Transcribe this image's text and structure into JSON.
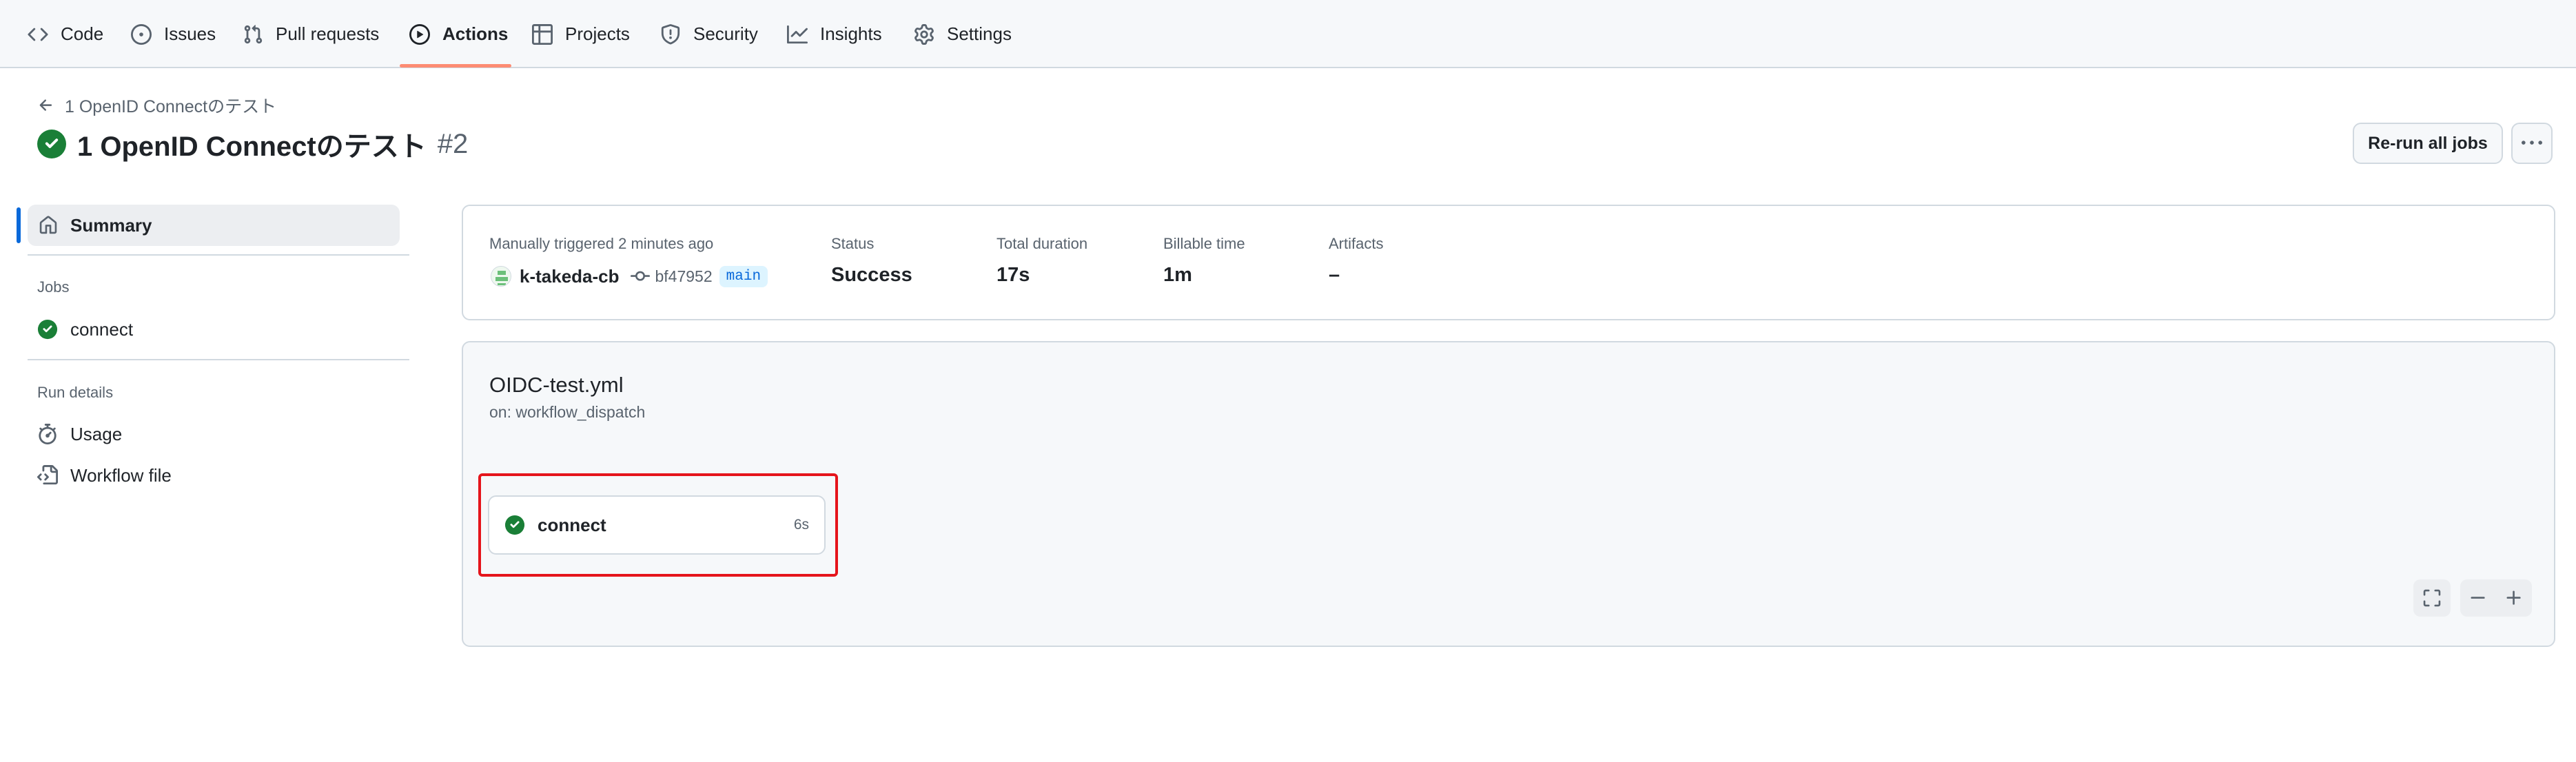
{
  "nav": {
    "tabs": [
      {
        "label": "Code",
        "icon": "code-icon"
      },
      {
        "label": "Issues",
        "icon": "issue-opened-icon"
      },
      {
        "label": "Pull requests",
        "icon": "git-pull-request-icon"
      },
      {
        "label": "Actions",
        "icon": "play-icon",
        "active": true
      },
      {
        "label": "Projects",
        "icon": "table-icon"
      },
      {
        "label": "Security",
        "icon": "shield-icon"
      },
      {
        "label": "Insights",
        "icon": "graph-icon"
      },
      {
        "label": "Settings",
        "icon": "gear-icon"
      }
    ]
  },
  "header": {
    "back_label": "1 OpenID Connectのテスト",
    "title": "1 OpenID Connectのテスト",
    "run_number": "#2",
    "rerun_label": "Re-run all jobs"
  },
  "sidebar": {
    "summary_label": "Summary",
    "jobs_heading": "Jobs",
    "jobs": [
      {
        "label": "connect",
        "status": "success"
      }
    ],
    "run_details_heading": "Run details",
    "details": [
      {
        "label": "Usage",
        "icon": "stopwatch-icon"
      },
      {
        "label": "Workflow file",
        "icon": "file-code-icon"
      }
    ]
  },
  "summary": {
    "trigger_text": "Manually triggered 2 minutes ago",
    "actor": "k-takeda-cb",
    "commit_sha": "bf47952",
    "branch": "main",
    "status_label": "Status",
    "status_value": "Success",
    "duration_label": "Total duration",
    "duration_value": "17s",
    "billable_label": "Billable time",
    "billable_value": "1m",
    "artifacts_label": "Artifacts",
    "artifacts_value": "–"
  },
  "graph": {
    "workflow_file": "OIDC-test.yml",
    "trigger": "on: workflow_dispatch",
    "job": {
      "name": "connect",
      "duration": "6s",
      "status": "success"
    }
  },
  "colors": {
    "success": "#1a7f37",
    "accent_underline": "#fd8c73",
    "link_blue": "#0969da",
    "highlight_red": "#e5141b"
  }
}
